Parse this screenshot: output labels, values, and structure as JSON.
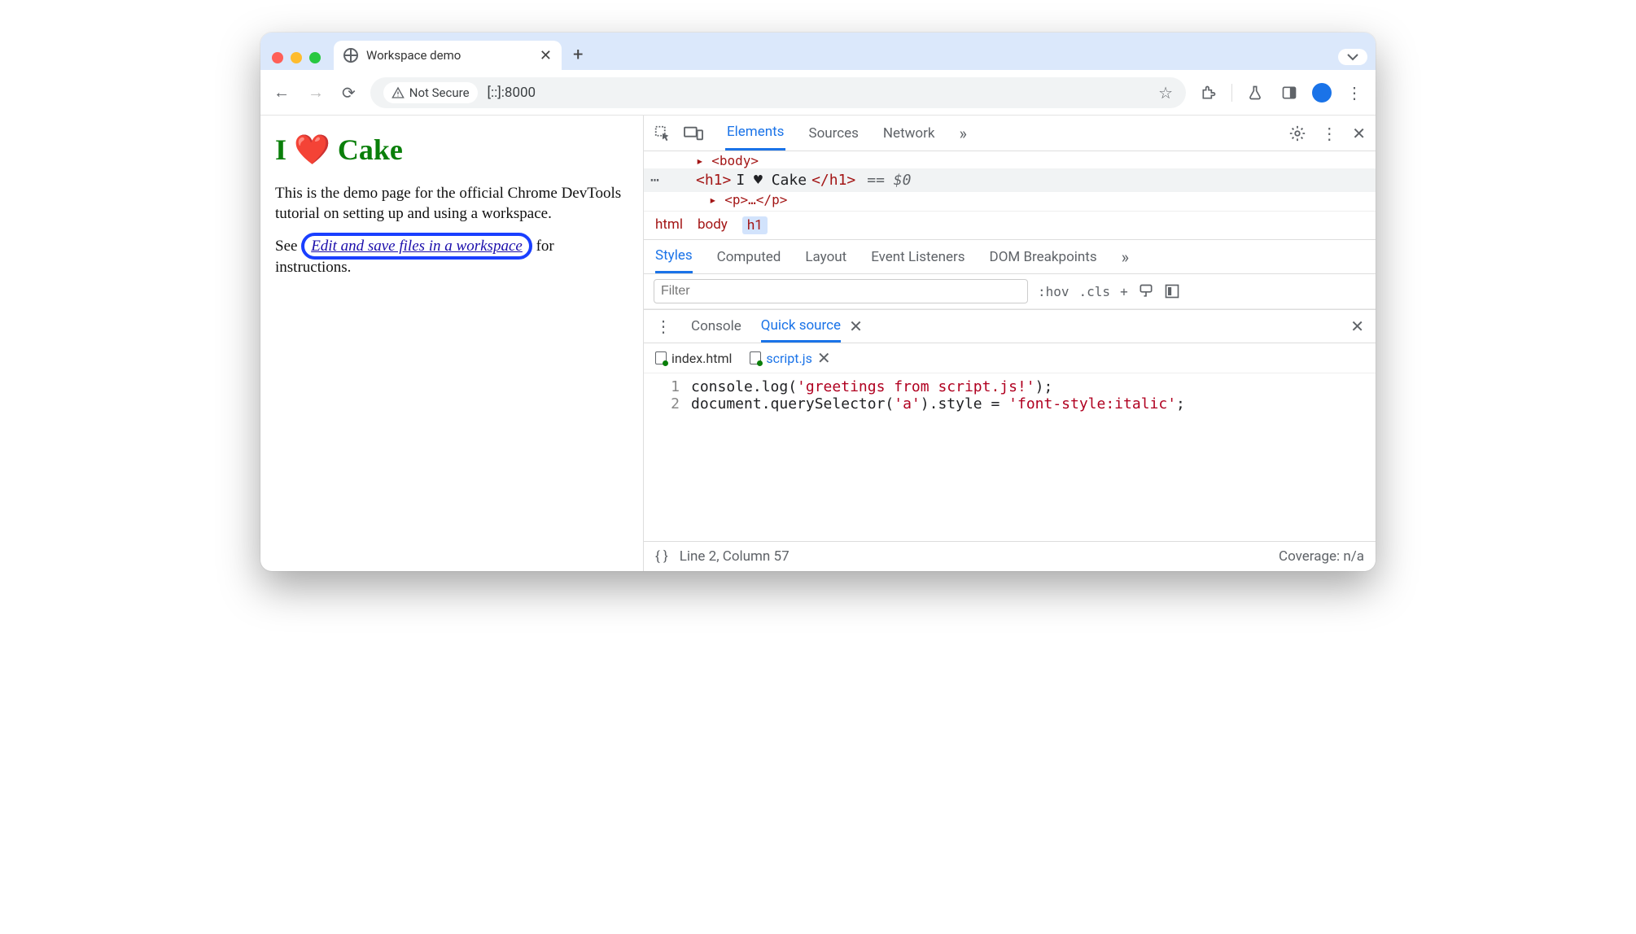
{
  "browser": {
    "tab_title": "Workspace demo",
    "security_chip": "Not Secure",
    "url": "[::]:8000"
  },
  "page": {
    "h1_pre": "I ",
    "h1_emoji": "❤️",
    "h1_post": " Cake",
    "p1": "This is the demo page for the official Chrome DevTools tutorial on setting up and using a workspace.",
    "p2_pre": "See ",
    "p2_link": "Edit and save files in a workspace",
    "p2_post": " for instructions."
  },
  "devtools": {
    "tabs": [
      "Elements",
      "Sources",
      "Network"
    ],
    "active_tab": "Elements",
    "dom_above": "<body>",
    "dom_line_open": "<h1>",
    "dom_line_text": "I ♥ Cake",
    "dom_line_close": "</h1>",
    "dom_eq": "== $0",
    "dom_below": "<p>…</p>",
    "breadcrumbs": [
      "html",
      "body",
      "h1"
    ],
    "styles_tabs": [
      "Styles",
      "Computed",
      "Layout",
      "Event Listeners",
      "DOM Breakpoints"
    ],
    "styles_active": "Styles",
    "filter_placeholder": "Filter",
    "hov": ":hov",
    "cls": ".cls",
    "drawer_tabs": [
      "Console",
      "Quick source"
    ],
    "drawer_active": "Quick source",
    "file_tabs": [
      "index.html",
      "script.js"
    ],
    "file_active": "script.js",
    "code_lines": [
      {
        "n": "1",
        "plain1": "console.log(",
        "str": "'greetings from script.js!'",
        "plain2": ");"
      },
      {
        "n": "2",
        "plain1": "document.querySelector(",
        "str": "'a'",
        "plain2": ").style = ",
        "str2": "'font-style:italic'",
        "plain3": ";"
      }
    ],
    "status_pos": "Line 2, Column 57",
    "coverage": "Coverage: n/a"
  }
}
